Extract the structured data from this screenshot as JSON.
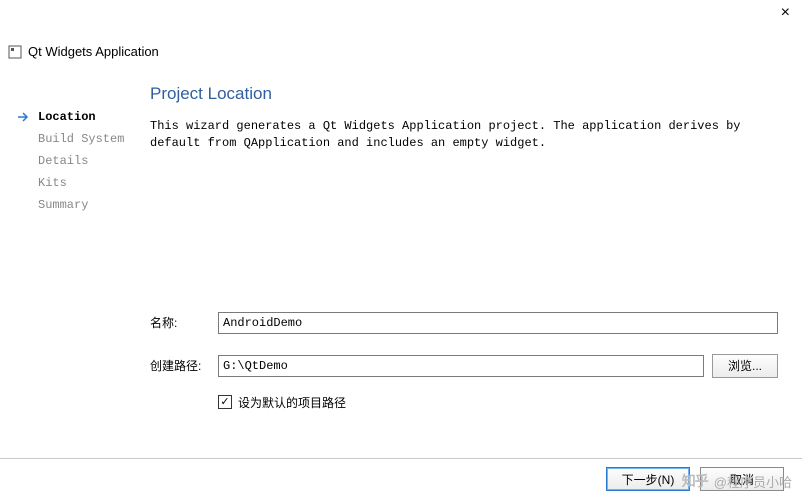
{
  "window": {
    "app_title": "Qt Widgets Application"
  },
  "sidebar": {
    "items": [
      {
        "label": "Location",
        "current": true
      },
      {
        "label": "Build System",
        "current": false
      },
      {
        "label": "Details",
        "current": false
      },
      {
        "label": "Kits",
        "current": false
      },
      {
        "label": "Summary",
        "current": false
      }
    ]
  },
  "page": {
    "title": "Project Location",
    "description": "This wizard generates a Qt Widgets Application project. The application derives by default from QApplication and includes an empty widget."
  },
  "form": {
    "name_label": "名称:",
    "name_value": "AndroidDemo",
    "path_label": "创建路径:",
    "path_value": "G:\\QtDemo",
    "browse_label": "浏览...",
    "default_path_checked": true,
    "default_path_label": "设为默认的项目路径"
  },
  "buttons": {
    "next": "下一步(N)",
    "cancel": "取消"
  },
  "watermark": {
    "logo": "知乎",
    "text": "@程序员小哈"
  }
}
